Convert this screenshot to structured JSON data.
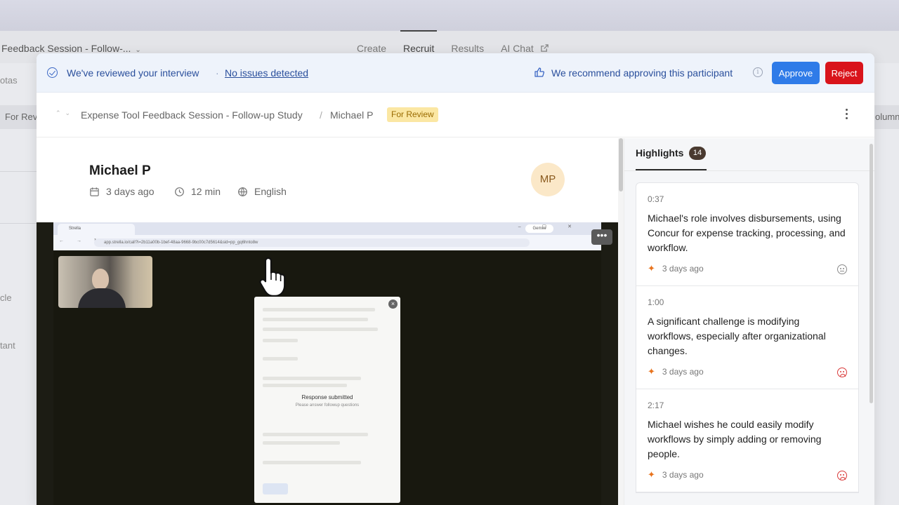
{
  "background": {
    "study_title": "Feedback Session - Follow-...",
    "tabs": [
      "Create",
      "Recruit",
      "Results",
      "AI Chat"
    ],
    "active_tab": "Recruit",
    "side_labels": [
      "otas",
      "For Rev",
      "cle",
      "tant"
    ],
    "right_label": "olumn"
  },
  "banner": {
    "reviewed_text": "We've reviewed your interview",
    "separator": "·",
    "issues_link": "No issues detected",
    "recommend_text": "We recommend approving this participant",
    "approve_label": "Approve",
    "reject_label": "Reject",
    "info_glyph": "i"
  },
  "breadcrumb": {
    "study": "Expense Tool Feedback Session - Follow-up Study",
    "separator": "/",
    "participant": "Michael P",
    "status_badge": "For Review"
  },
  "participant": {
    "name": "Michael P",
    "date": "3 days ago",
    "duration": "12 min",
    "language": "English",
    "avatar_initials": "MP"
  },
  "video": {
    "tab_title": "Strella",
    "gemini_label": "Gemini",
    "address": "app.strella.io/call?i=2b11a00b-1bef-48aa-9668-9bc00c7d5614&sid=pp_gq6hnto8w",
    "response_title": "Response submitted",
    "response_sub": "Please answer followup questions",
    "more_glyph": "•••",
    "close_glyph": "×"
  },
  "highlights": {
    "tab_label": "Highlights",
    "count": "14",
    "items": [
      {
        "time": "0:37",
        "text": "Michael's role involves disbursements, using Concur for expense tracking, processing, and workflow.",
        "age": "3 days ago",
        "sentiment": "neutral"
      },
      {
        "time": "1:00",
        "text": "A significant challenge is modifying workflows, especially after organizational changes.",
        "age": "3 days ago",
        "sentiment": "negative"
      },
      {
        "time": "2:17",
        "text": "Michael wishes he could easily modify workflows by simply adding or removing people.",
        "age": "3 days ago",
        "sentiment": "negative"
      }
    ]
  },
  "colors": {
    "accent_blue": "#2f7be8",
    "reject_red": "#d9141b",
    "badge_yellow": "#fbe7a3",
    "spark_orange": "#e8731d"
  }
}
